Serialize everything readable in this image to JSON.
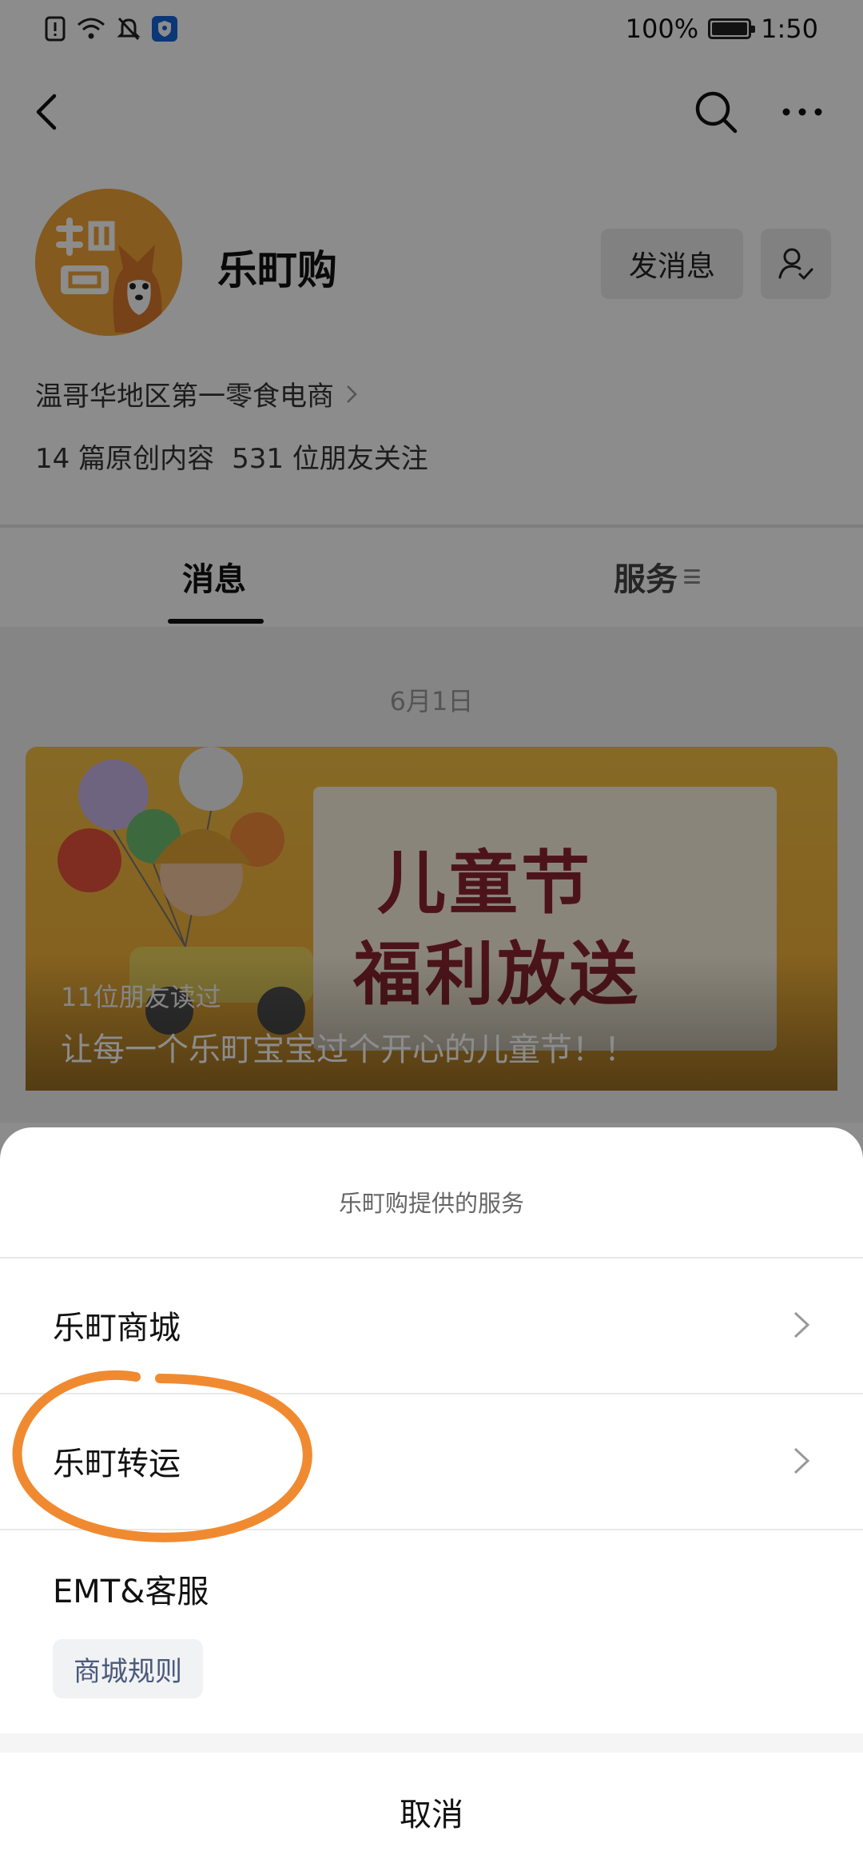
{
  "status_bar": {
    "battery": "100%",
    "battery_level": 1.0,
    "time": "1:50"
  },
  "profile": {
    "name": "乐町购",
    "send_message": "发消息",
    "description": "温哥华地区第一零食电商",
    "original_count": "14 篇原创内容",
    "followers": "531 位朋友关注"
  },
  "tabs": {
    "messages": "消息",
    "services": "服务"
  },
  "feed": {
    "date": "6月1日",
    "article": {
      "headline_line1": "儿童节",
      "headline_line2": "福利放送",
      "read_count": "11位朋友读过",
      "title": "让每一个乐町宝宝过个开心的儿童节！！"
    }
  },
  "sheet": {
    "title": "乐町购提供的服务",
    "items": [
      {
        "label": "乐町商城"
      },
      {
        "label": "乐町转运"
      }
    ],
    "group_label": "EMT&客服",
    "group_chip": "商城规则",
    "cancel": "取消"
  },
  "colors": {
    "avatar": "#f0a43a",
    "card": "#f2b23a",
    "headline": "#8a2630",
    "annotation": "#f08a30",
    "status_shield": "#1565d8"
  },
  "icons": [
    "sim-alert-icon",
    "wifi-icon",
    "bell-off-icon",
    "shield-icon",
    "battery-icon",
    "back-icon",
    "search-icon",
    "more-icon",
    "follow-user-icon",
    "chevron-right-icon"
  ]
}
